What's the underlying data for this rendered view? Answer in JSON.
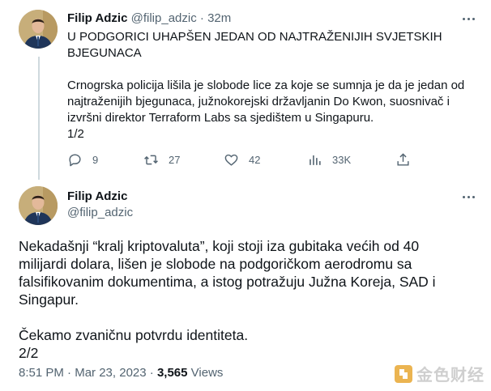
{
  "tweet1": {
    "author_name": "Filip Adzic",
    "handle": "@filip_adzic",
    "separator": "·",
    "time": "32m",
    "headline_line1": "U PODGORICI UHAPŠEN JEDAN OD NAJTRAŽENIJIH SVJETSKIH",
    "headline_line2": "BJEGUNACA",
    "body_line1": "Crnogrska policija lišila je slobode lice za koje se sumnja je da je jedan od",
    "body_line2": "najtraženijih bjegunaca, južnokorejski državljanin Do Kwon, suosnivač i",
    "body_line3": "izvršni direktor Terraform Labs sa sjedištem u Singapuru.",
    "body_line4": "1/2",
    "actions": {
      "replies": "9",
      "retweets": "27",
      "likes": "42",
      "views": "33K"
    }
  },
  "tweet2": {
    "author_name": "Filip Adzic",
    "handle": "@filip_adzic",
    "body_line1": "Nekadašnji “kralj kriptovaluta”, koji stoji iza gubitaka većih od 40",
    "body_line2": "milijardi dolara, lišen je slobode na podgoričkom aerodromu sa",
    "body_line3": "falsifikovanim dokumentima, a istog potražuju Južna Koreja, SAD i",
    "body_line4": "Singapur.",
    "body_line5": "Čekamo zvaničnu potvrdu identiteta.",
    "body_line6": "2/2",
    "time": "8:51 PM",
    "date": "Mar 23, 2023",
    "views_count": "3,565",
    "views_label": "Views"
  },
  "watermark": {
    "text": "金色财经"
  },
  "colors": {
    "text": "#0f1419",
    "muted": "#536471",
    "thread_line": "#cfd9de",
    "watermark_gold": "#e8a733"
  }
}
